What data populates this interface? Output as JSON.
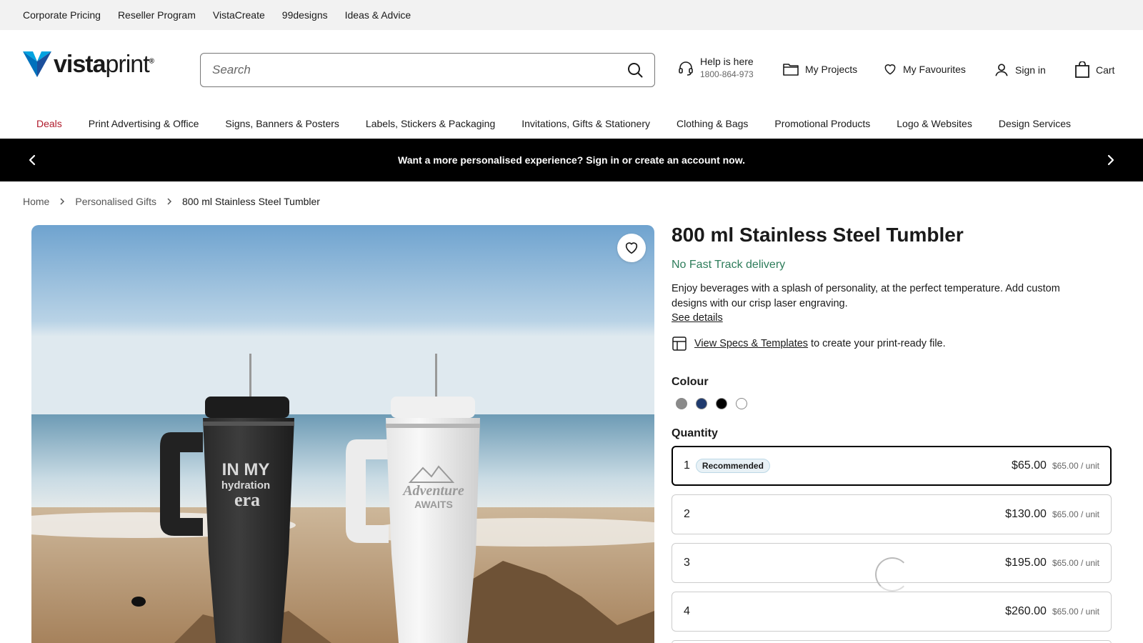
{
  "utility_links": [
    "Corporate Pricing",
    "Reseller Program",
    "VistaCreate",
    "99designs",
    "Ideas & Advice"
  ],
  "logo": {
    "bold": "vista",
    "light": "print",
    "mark": "®"
  },
  "search": {
    "placeholder": "Search"
  },
  "header": {
    "help_title": "Help is here",
    "help_phone": "1800-864-973",
    "projects": "My Projects",
    "favourites": "My Favourites",
    "signin": "Sign in",
    "cart": "Cart"
  },
  "nav": [
    "Deals",
    "Print Advertising & Office",
    "Signs, Banners & Posters",
    "Labels, Stickers & Packaging",
    "Invitations, Gifts & Stationery",
    "Clothing & Bags",
    "Promotional Products",
    "Logo & Websites",
    "Design Services"
  ],
  "promo": {
    "text": "Want a more personalised experience? Sign in or create an account now."
  },
  "breadcrumb": {
    "home": "Home",
    "category": "Personalised Gifts",
    "current": "800 ml Stainless Steel Tumbler"
  },
  "product": {
    "title": "800 ml Stainless Steel Tumbler",
    "delivery": "No Fast Track delivery",
    "description": "Enjoy beverages with a splash of personality, at the perfect temperature. Add custom designs with our crisp laser engraving.",
    "see_details": "See details",
    "specs_link": "View Specs & Templates",
    "specs_suffix": "to create your print-ready file.",
    "colour_label": "Colour",
    "colours": [
      "#8a8a8a",
      "#1f3a6e",
      "#000000",
      "#ffffff"
    ],
    "quantity_label": "Quantity",
    "quantities": [
      {
        "qty": "1",
        "badge": "Recommended",
        "price": "$65.00",
        "unit": "$65.00 / unit"
      },
      {
        "qty": "2",
        "badge": "",
        "price": "$130.00",
        "unit": "$65.00 / unit"
      },
      {
        "qty": "3",
        "badge": "",
        "price": "$195.00",
        "unit": "$65.00 / unit"
      },
      {
        "qty": "4",
        "badge": "",
        "price": "$260.00",
        "unit": "$65.00 / unit"
      }
    ]
  },
  "image_text": {
    "black_tumbler": [
      "IN MY",
      "hydration",
      "era"
    ],
    "white_tumbler": [
      "Adventure",
      "AWAITS"
    ]
  }
}
